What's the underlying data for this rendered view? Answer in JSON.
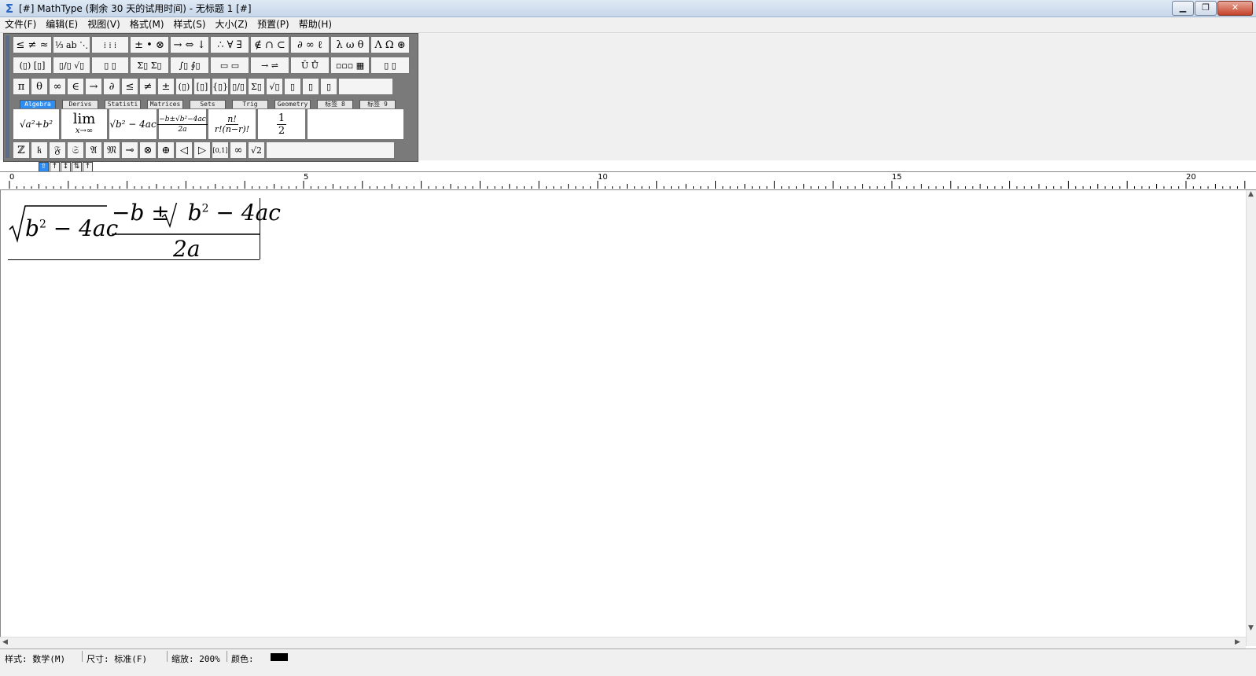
{
  "window": {
    "title": "[#] MathType (剩余 30 天的试用时间) - 无标题 1 [#]",
    "minimize": "▁",
    "restore": "❐",
    "close": "✕"
  },
  "menu": [
    "文件(F)",
    "编辑(E)",
    "视图(V)",
    "格式(M)",
    "样式(S)",
    "大小(Z)",
    "预置(P)",
    "帮助(H)"
  ],
  "symbols_row1": [
    "≤ ≠ ≈",
    "⅓ ab ⋱",
    "⁞ ⁞ ⁞",
    "± • ⊗",
    "→ ⇔ ↓",
    "∴ ∀ ∃",
    "∉ ∩ ⊂",
    "∂ ∞ ℓ",
    "λ ω θ",
    "Λ Ω ⊛"
  ],
  "symbols_row2": [
    "(▯) [▯]",
    "▯/▯ √▯",
    "▯ ▯",
    "Σ▯ Σ▯",
    "∫▯ ∮▯",
    "▭ ▭",
    "→ ⇌",
    "Ū Ů",
    "▫▫▫ ▦",
    "▯ ▯"
  ],
  "symbols_row3": [
    "π",
    "θ",
    "∞",
    "∈",
    "→",
    "∂",
    "≤",
    "≠",
    "±",
    "(▯)",
    "[▯]",
    "{▯}",
    "▯/▯",
    "Σ▯",
    "√▯",
    "▯",
    "▯",
    "▯"
  ],
  "tabs": [
    "Algebra",
    "Derivs",
    "Statisti",
    "Matrices",
    "Sets",
    "Trig",
    "Geometry",
    "标签 8",
    "标签 9"
  ],
  "templates": [
    "√a²+b²",
    "lim",
    "x→∞",
    "√b² − 4ac",
    "−b±√b²−4ac",
    "2a",
    "n!",
    "r!(n−r)!",
    "1",
    "2"
  ],
  "symbols_row5": [
    "ℤ",
    "𝔨",
    "𝔉",
    "𝔖",
    "𝔄",
    "𝔐",
    "⊸",
    "⊗",
    "⊕",
    "◁",
    "▷",
    "[0,1]",
    "∞",
    "√2"
  ],
  "nudge": [
    "⇧",
    "↑",
    "↕",
    "⇅",
    "↑"
  ],
  "ruler_labels": [
    "0",
    "5",
    "10",
    "15",
    "20"
  ],
  "equation": {
    "rad1_base": "b",
    "rad1_exp": "2",
    "rad1_rest": " − 4ac",
    "num_prefix": "−b ± ",
    "num_rad_base": "b",
    "num_rad_exp": "2",
    "num_rad_rest": " − 4ac",
    "den": "2a"
  },
  "status": {
    "style": "样式: 数学(M)",
    "size": "尺寸: 标准(F)",
    "zoom": "缩放: 200%",
    "color": "颜色:"
  }
}
